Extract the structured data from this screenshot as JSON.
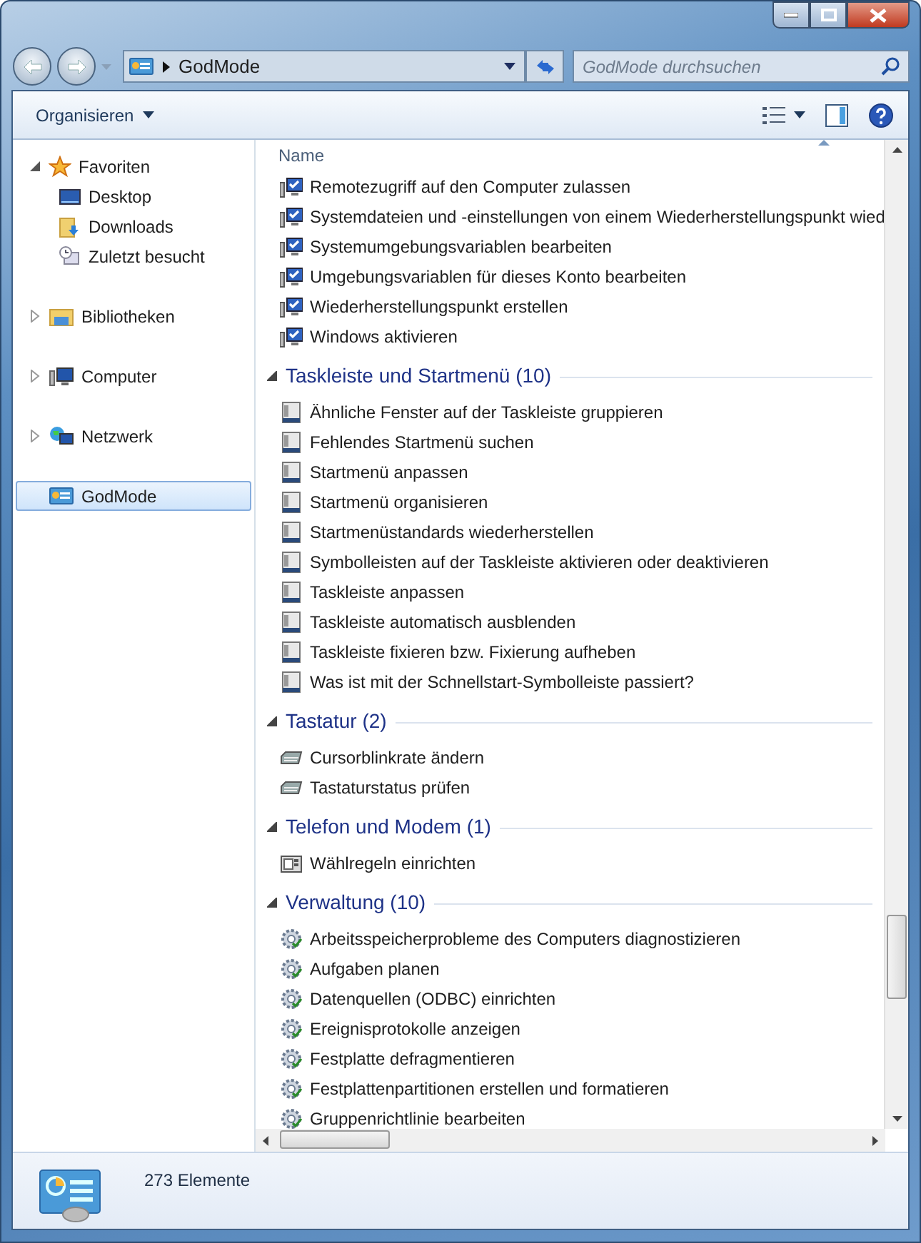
{
  "address": {
    "location": "GodMode"
  },
  "search": {
    "placeholder": "GodMode durchsuchen"
  },
  "toolbar": {
    "organize": "Organisieren"
  },
  "navigation": [
    {
      "label": "Favoriten",
      "kind": "star",
      "expanded": true,
      "selected": false,
      "children": [
        {
          "label": "Desktop",
          "kind": "desktop",
          "selected": false
        },
        {
          "label": "Downloads",
          "kind": "downloads",
          "selected": false
        },
        {
          "label": "Zuletzt besucht",
          "kind": "recent",
          "selected": false
        }
      ]
    },
    {
      "label": "Bibliotheken",
      "kind": "library",
      "expanded": false,
      "selected": false
    },
    {
      "label": "Computer",
      "kind": "computer",
      "expanded": false,
      "selected": false
    },
    {
      "label": "Netzwerk",
      "kind": "network",
      "expanded": false,
      "selected": false
    },
    {
      "label": "GodMode",
      "kind": "panel",
      "selected": true
    }
  ],
  "list": {
    "column": "Name",
    "groups": [
      {
        "kind": "system",
        "items": [
          "Remotezugriff auf den Computer zulassen",
          "Systemdateien und -einstellungen von einem Wiederherstellungspunkt wied",
          "Systemumgebungsvariablen bearbeiten",
          "Umgebungsvariablen für dieses Konto bearbeiten",
          "Wiederherstellungspunkt erstellen",
          "Windows aktivieren"
        ]
      },
      {
        "title": "Taskleiste und Startmenü (10)",
        "expanded": true,
        "kind": "taskbar",
        "items": [
          "Ähnliche Fenster auf der Taskleiste gruppieren",
          "Fehlendes Startmenü suchen",
          "Startmenü anpassen",
          "Startmenü organisieren",
          "Startmenüstandards wiederherstellen",
          "Symbolleisten auf der Taskleiste aktivieren oder deaktivieren",
          "Taskleiste anpassen",
          "Taskleiste automatisch ausblenden",
          "Taskleiste fixieren bzw. Fixierung aufheben",
          "Was ist mit der Schnellstart-Symbolleiste passiert?"
        ]
      },
      {
        "title": "Tastatur (2)",
        "expanded": true,
        "kind": "keyboard",
        "items": [
          "Cursorblinkrate ändern",
          "Tastaturstatus prüfen"
        ]
      },
      {
        "title": "Telefon und Modem (1)",
        "expanded": true,
        "kind": "phone",
        "items": [
          "Wählregeln einrichten"
        ]
      },
      {
        "title": "Verwaltung (10)",
        "expanded": true,
        "kind": "admin",
        "items": [
          "Arbeitsspeicherprobleme des Computers diagnostizieren",
          "Aufgaben planen",
          "Datenquellen (ODBC) einrichten",
          "Ereignisprotokolle anzeigen",
          "Festplatte defragmentieren",
          "Festplattenpartitionen erstellen und formatieren",
          "Gruppenrichtlinie bearbeiten"
        ]
      }
    ]
  },
  "status_bar": {
    "count": "273 Elemente"
  }
}
